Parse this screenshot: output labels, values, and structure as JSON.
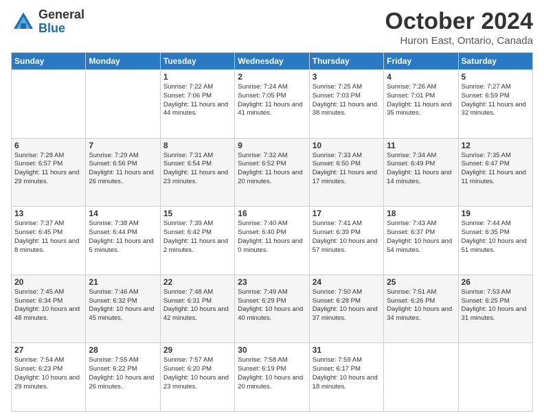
{
  "header": {
    "logo_general": "General",
    "logo_blue": "Blue",
    "month": "October 2024",
    "location": "Huron East, Ontario, Canada"
  },
  "days_of_week": [
    "Sunday",
    "Monday",
    "Tuesday",
    "Wednesday",
    "Thursday",
    "Friday",
    "Saturday"
  ],
  "weeks": [
    [
      {
        "day": "",
        "info": ""
      },
      {
        "day": "",
        "info": ""
      },
      {
        "day": "1",
        "info": "Sunrise: 7:22 AM\nSunset: 7:06 PM\nDaylight: 11 hours and 44 minutes."
      },
      {
        "day": "2",
        "info": "Sunrise: 7:24 AM\nSunset: 7:05 PM\nDaylight: 11 hours and 41 minutes."
      },
      {
        "day": "3",
        "info": "Sunrise: 7:25 AM\nSunset: 7:03 PM\nDaylight: 11 hours and 38 minutes."
      },
      {
        "day": "4",
        "info": "Sunrise: 7:26 AM\nSunset: 7:01 PM\nDaylight: 11 hours and 35 minutes."
      },
      {
        "day": "5",
        "info": "Sunrise: 7:27 AM\nSunset: 6:59 PM\nDaylight: 11 hours and 32 minutes."
      }
    ],
    [
      {
        "day": "6",
        "info": "Sunrise: 7:28 AM\nSunset: 6:57 PM\nDaylight: 11 hours and 29 minutes."
      },
      {
        "day": "7",
        "info": "Sunrise: 7:29 AM\nSunset: 6:56 PM\nDaylight: 11 hours and 26 minutes."
      },
      {
        "day": "8",
        "info": "Sunrise: 7:31 AM\nSunset: 6:54 PM\nDaylight: 11 hours and 23 minutes."
      },
      {
        "day": "9",
        "info": "Sunrise: 7:32 AM\nSunset: 6:52 PM\nDaylight: 11 hours and 20 minutes."
      },
      {
        "day": "10",
        "info": "Sunrise: 7:33 AM\nSunset: 6:50 PM\nDaylight: 11 hours and 17 minutes."
      },
      {
        "day": "11",
        "info": "Sunrise: 7:34 AM\nSunset: 6:49 PM\nDaylight: 11 hours and 14 minutes."
      },
      {
        "day": "12",
        "info": "Sunrise: 7:35 AM\nSunset: 6:47 PM\nDaylight: 11 hours and 11 minutes."
      }
    ],
    [
      {
        "day": "13",
        "info": "Sunrise: 7:37 AM\nSunset: 6:45 PM\nDaylight: 11 hours and 8 minutes."
      },
      {
        "day": "14",
        "info": "Sunrise: 7:38 AM\nSunset: 6:44 PM\nDaylight: 11 hours and 5 minutes."
      },
      {
        "day": "15",
        "info": "Sunrise: 7:39 AM\nSunset: 6:42 PM\nDaylight: 11 hours and 2 minutes."
      },
      {
        "day": "16",
        "info": "Sunrise: 7:40 AM\nSunset: 6:40 PM\nDaylight: 11 hours and 0 minutes."
      },
      {
        "day": "17",
        "info": "Sunrise: 7:41 AM\nSunset: 6:39 PM\nDaylight: 10 hours and 57 minutes."
      },
      {
        "day": "18",
        "info": "Sunrise: 7:43 AM\nSunset: 6:37 PM\nDaylight: 10 hours and 54 minutes."
      },
      {
        "day": "19",
        "info": "Sunrise: 7:44 AM\nSunset: 6:35 PM\nDaylight: 10 hours and 51 minutes."
      }
    ],
    [
      {
        "day": "20",
        "info": "Sunrise: 7:45 AM\nSunset: 6:34 PM\nDaylight: 10 hours and 48 minutes."
      },
      {
        "day": "21",
        "info": "Sunrise: 7:46 AM\nSunset: 6:32 PM\nDaylight: 10 hours and 45 minutes."
      },
      {
        "day": "22",
        "info": "Sunrise: 7:48 AM\nSunset: 6:31 PM\nDaylight: 10 hours and 42 minutes."
      },
      {
        "day": "23",
        "info": "Sunrise: 7:49 AM\nSunset: 6:29 PM\nDaylight: 10 hours and 40 minutes."
      },
      {
        "day": "24",
        "info": "Sunrise: 7:50 AM\nSunset: 6:28 PM\nDaylight: 10 hours and 37 minutes."
      },
      {
        "day": "25",
        "info": "Sunrise: 7:51 AM\nSunset: 6:26 PM\nDaylight: 10 hours and 34 minutes."
      },
      {
        "day": "26",
        "info": "Sunrise: 7:53 AM\nSunset: 6:25 PM\nDaylight: 10 hours and 31 minutes."
      }
    ],
    [
      {
        "day": "27",
        "info": "Sunrise: 7:54 AM\nSunset: 6:23 PM\nDaylight: 10 hours and 29 minutes."
      },
      {
        "day": "28",
        "info": "Sunrise: 7:55 AM\nSunset: 6:22 PM\nDaylight: 10 hours and 26 minutes."
      },
      {
        "day": "29",
        "info": "Sunrise: 7:57 AM\nSunset: 6:20 PM\nDaylight: 10 hours and 23 minutes."
      },
      {
        "day": "30",
        "info": "Sunrise: 7:58 AM\nSunset: 6:19 PM\nDaylight: 10 hours and 20 minutes."
      },
      {
        "day": "31",
        "info": "Sunrise: 7:59 AM\nSunset: 6:17 PM\nDaylight: 10 hours and 18 minutes."
      },
      {
        "day": "",
        "info": ""
      },
      {
        "day": "",
        "info": ""
      }
    ]
  ]
}
